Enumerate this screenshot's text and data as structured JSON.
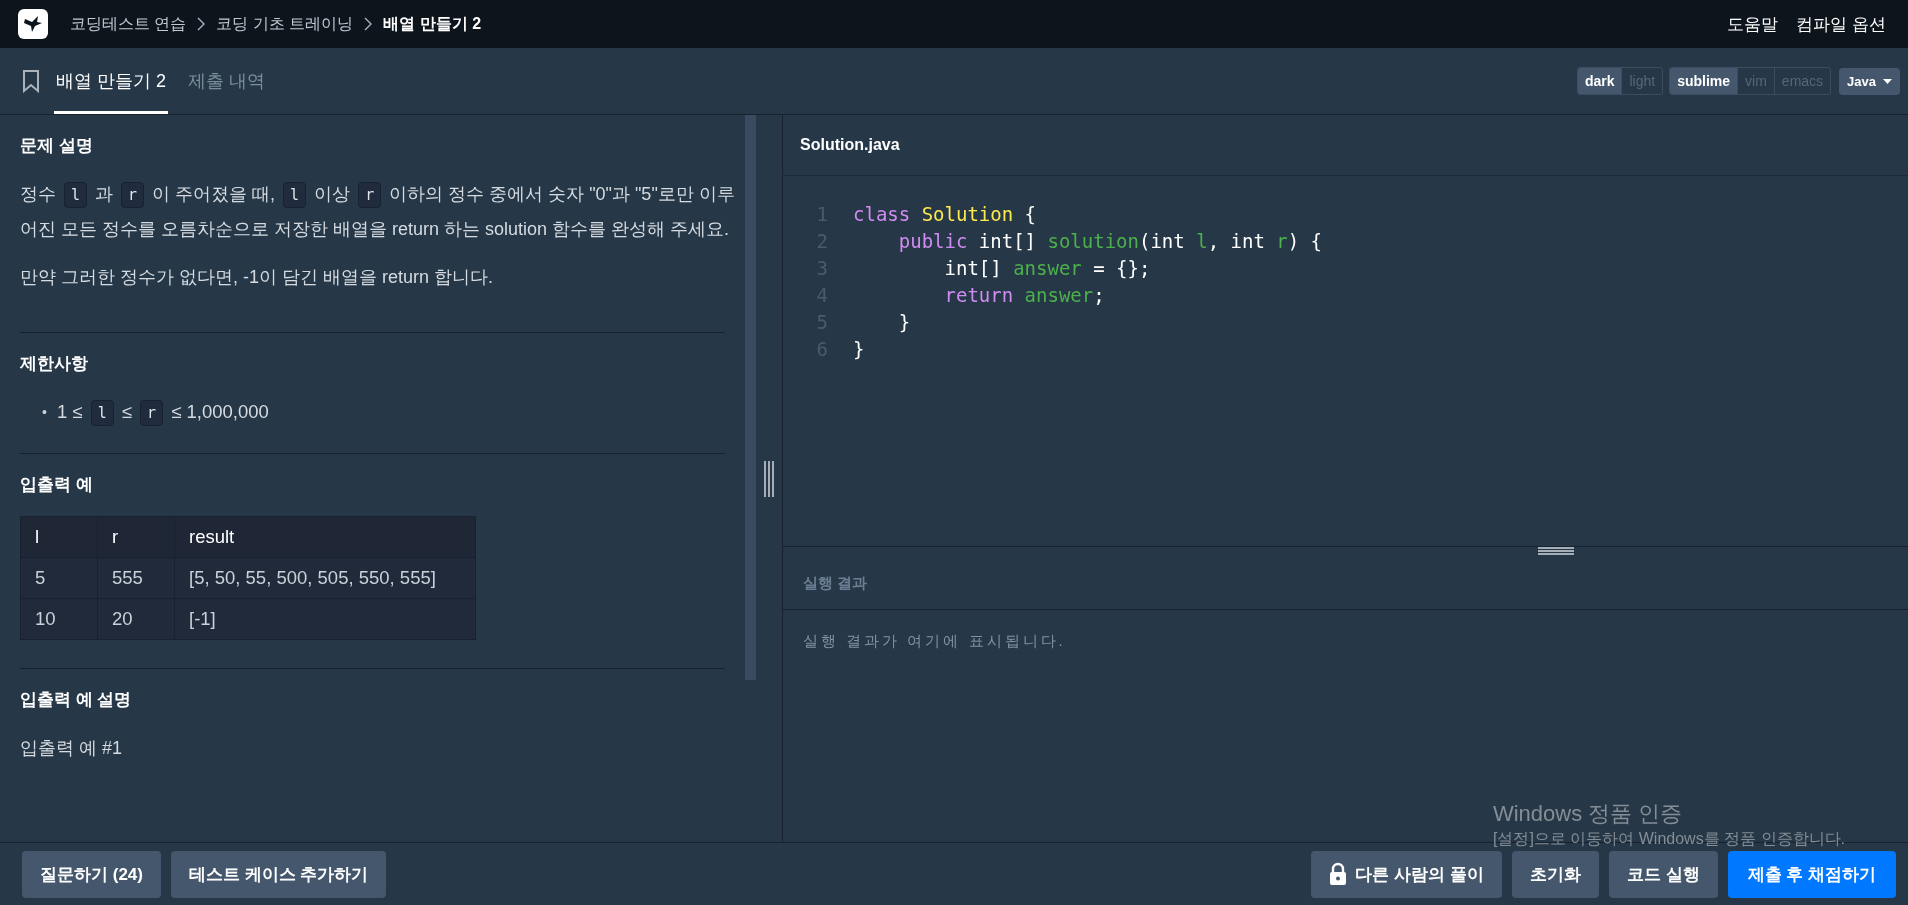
{
  "breadcrumb": [
    {
      "label": "코딩테스트 연습",
      "current": false
    },
    {
      "label": "코딩 기초 트레이닝",
      "current": false
    },
    {
      "label": "배열 만들기 2",
      "current": true
    }
  ],
  "top_links": [
    "도움말",
    "컴파일 옵션"
  ],
  "tabs": [
    {
      "label": "배열 만들기 2",
      "selected": true
    },
    {
      "label": "제출 내역",
      "selected": false
    }
  ],
  "theme_toggle": [
    {
      "label": "dark",
      "selected": true
    },
    {
      "label": "light",
      "selected": false
    }
  ],
  "keymap_toggle": [
    {
      "label": "sublime",
      "selected": true
    },
    {
      "label": "vim",
      "selected": false
    },
    {
      "label": "emacs",
      "selected": false
    }
  ],
  "language": {
    "label": "Java"
  },
  "problem": {
    "sections": [
      {
        "kind": "text",
        "title": "문제 설명",
        "paragraphs": [
          [
            {
              "kind": "text",
              "text": "정수 "
            },
            {
              "kind": "code",
              "text": "l"
            },
            {
              "kind": "text",
              "text": " 과 "
            },
            {
              "kind": "code",
              "text": "r"
            },
            {
              "kind": "text",
              "text": " 이 주어졌을 때, "
            },
            {
              "kind": "code",
              "text": "l"
            },
            {
              "kind": "text",
              "text": " 이상 "
            },
            {
              "kind": "code",
              "text": "r"
            },
            {
              "kind": "text",
              "text": " 이하의 정수 중에서 숫자 \"0\"과 \"5\"로만 이루어진 모든 정수를 오름차순으로 저장한 배열을 return 하는 solution 함수를 완성해 주세요."
            }
          ],
          [
            {
              "kind": "text",
              "text": "만약 그러한 정수가 없다면, -1이 담긴 배열을 return 합니다."
            }
          ]
        ]
      },
      {
        "kind": "list",
        "title": "제한사항",
        "items": [
          {
            "marker": "•",
            "parts": [
              {
                "kind": "text",
                "text": "1 ≤ "
              },
              {
                "kind": "code",
                "text": "l"
              },
              {
                "kind": "text",
                "text": " ≤ "
              },
              {
                "kind": "code",
                "text": "r"
              },
              {
                "kind": "text",
                "text": " ≤ 1,000,000"
              }
            ]
          }
        ]
      },
      {
        "kind": "table",
        "title": "입출력 예",
        "columns": [
          "l",
          "r",
          "result"
        ],
        "rows": [
          [
            "5",
            "555",
            "[5, 50, 55, 500, 505, 550, 555]"
          ],
          [
            "10",
            "20",
            "[-1]"
          ]
        ]
      },
      {
        "kind": "text",
        "title": "입출력 예 설명",
        "paragraphs": [
          [
            {
              "kind": "text",
              "text": "입출력 예 #1"
            }
          ]
        ]
      }
    ]
  },
  "editor": {
    "filename": "Solution.java",
    "lines": [
      {
        "number": "1",
        "tokens": [
          {
            "kind": "keyword",
            "text": "class"
          },
          {
            "kind": "type",
            "text": " Solution"
          },
          {
            "kind": "plain",
            "text": " {"
          }
        ]
      },
      {
        "number": "2",
        "tokens": [
          {
            "kind": "keyword",
            "text": "    public"
          },
          {
            "kind": "plain",
            "text": " int[] "
          },
          {
            "kind": "name",
            "text": "solution"
          },
          {
            "kind": "plain",
            "text": "(int "
          },
          {
            "kind": "name",
            "text": "l"
          },
          {
            "kind": "plain",
            "text": ", int "
          },
          {
            "kind": "name",
            "text": "r"
          },
          {
            "kind": "plain",
            "text": ") {"
          }
        ]
      },
      {
        "number": "3",
        "tokens": [
          {
            "kind": "plain",
            "text": "        int[] "
          },
          {
            "kind": "name",
            "text": "answer"
          },
          {
            "kind": "plain",
            "text": " = {};"
          }
        ]
      },
      {
        "number": "4",
        "tokens": [
          {
            "kind": "keyword",
            "text": "        return"
          },
          {
            "kind": "name",
            "text": " answer"
          },
          {
            "kind": "plain",
            "text": ";"
          }
        ]
      },
      {
        "number": "5",
        "tokens": [
          {
            "kind": "plain",
            "text": "    }"
          }
        ]
      },
      {
        "number": "6",
        "tokens": [
          {
            "kind": "plain",
            "text": "}"
          }
        ]
      }
    ]
  },
  "result": {
    "title": "실행 결과",
    "message": "실행 결과가 여기에 표시됩니다."
  },
  "left_buttons": [
    "질문하기 (24)",
    "테스트 케이스 추가하기"
  ],
  "right_buttons": [
    {
      "label": "다른 사람의 풀이",
      "kind": "locked"
    },
    {
      "label": "초기화",
      "kind": "plain"
    },
    {
      "label": "코드 실행",
      "kind": "plain"
    },
    {
      "label": "제출 후 채점하기",
      "kind": "primary"
    }
  ],
  "os_notice": {
    "title": "Windows 정품 인증",
    "message": "[설정]으로 이동하여 Windows를 정품 인증합니다."
  }
}
